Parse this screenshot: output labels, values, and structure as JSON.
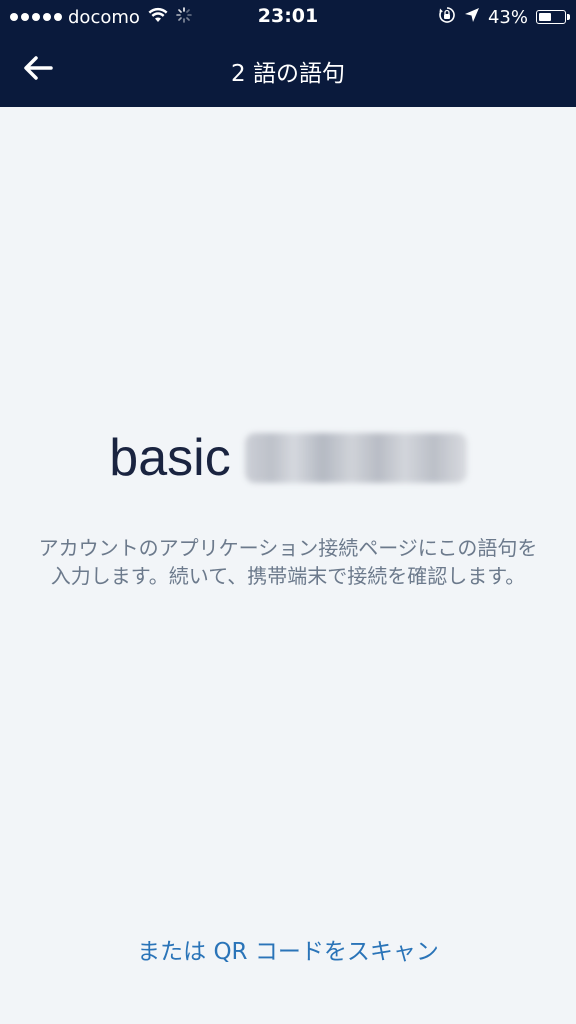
{
  "status_bar": {
    "carrier": "docomo",
    "time": "23:01",
    "battery_percent": "43%",
    "battery_level": 0.43
  },
  "nav": {
    "title": "2 語の語句",
    "back_icon": "arrow-left-icon"
  },
  "phrase": {
    "visible_word": "basic"
  },
  "instructions": "アカウントのアプリケーション接続ページにこの語句を入力します。続いて、携帯端末で接続を確認します。",
  "qr_link": "または QR コードをスキャン",
  "colors": {
    "header_bg": "#0a1a3c",
    "page_bg": "#f2f5f8",
    "phrase_text": "#1a2440",
    "instructions_text": "#6c7a8c",
    "link": "#2a74b8"
  }
}
